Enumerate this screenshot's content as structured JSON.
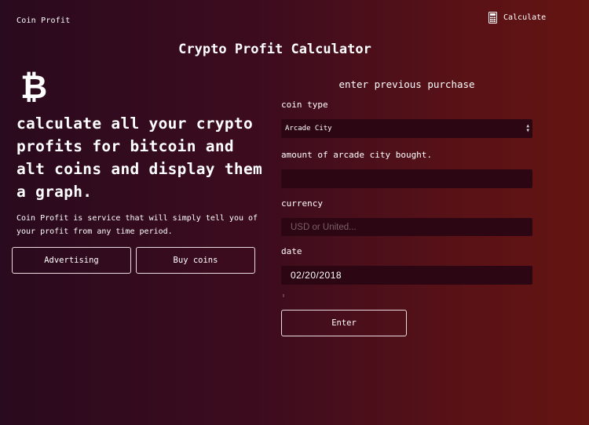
{
  "nav": {
    "brand": "Coin Profit",
    "calculate_label": "Calculate",
    "calculate_icon": "calculator-icon"
  },
  "title": "Crypto Profit Calculator",
  "hero": {
    "icon": "bitcoin-icon",
    "icon_glyph": "₿",
    "headline": "calculate all your crypto profits for bitcoin and alt coins and display them a graph.",
    "description": "Coin Profit is service that will simply tell you of your profit from any time period.",
    "buttons": [
      "Advertising",
      "Buy coins"
    ]
  },
  "form": {
    "heading": "enter previous purchase",
    "coin_label": "coin type",
    "coin_value": "Arcade City",
    "amount_label": "amount of arcade city bought.",
    "amount_value": "",
    "currency_label": "currency",
    "currency_placeholder": "USD or United...",
    "date_label": "date",
    "date_value": "02/20/2018",
    "submit_label": "Enter"
  },
  "colors": {
    "bg_left": "#2a0a1e",
    "bg_right": "#641411",
    "field_bg": "#2c0713",
    "button_border": "#e9dbe0"
  }
}
